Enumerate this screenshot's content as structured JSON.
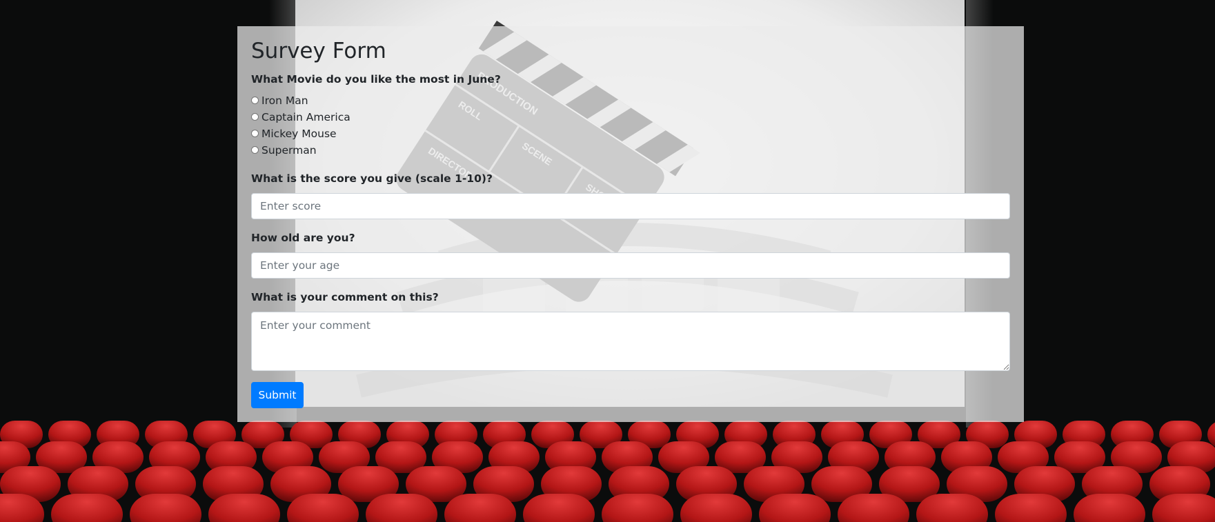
{
  "form": {
    "title": "Survey Form",
    "movie_question": "What Movie do you like the most in June?",
    "movie_options": [
      "Iron Man",
      "Captain America",
      "Mickey Mouse",
      "Superman"
    ],
    "score_question": "What is the score you give (scale 1-10)?",
    "score_placeholder": "Enter score",
    "score_value": "",
    "age_question": "How old are you?",
    "age_placeholder": "Enter your age",
    "age_value": "",
    "comment_question": "What is your comment on this?",
    "comment_placeholder": "Enter your comment",
    "comment_value": "",
    "submit_label": "Submit"
  },
  "background": {
    "clapperboard_labels": [
      "PRODUCTION",
      "ROLL",
      "SCENE",
      "SHOT",
      "DIRECTOR"
    ],
    "seat_color": "#c62020",
    "screen_color": "#f2f2f2"
  },
  "colors": {
    "primary": "#007bff",
    "text": "#212529",
    "placeholder": "#6c757d"
  }
}
